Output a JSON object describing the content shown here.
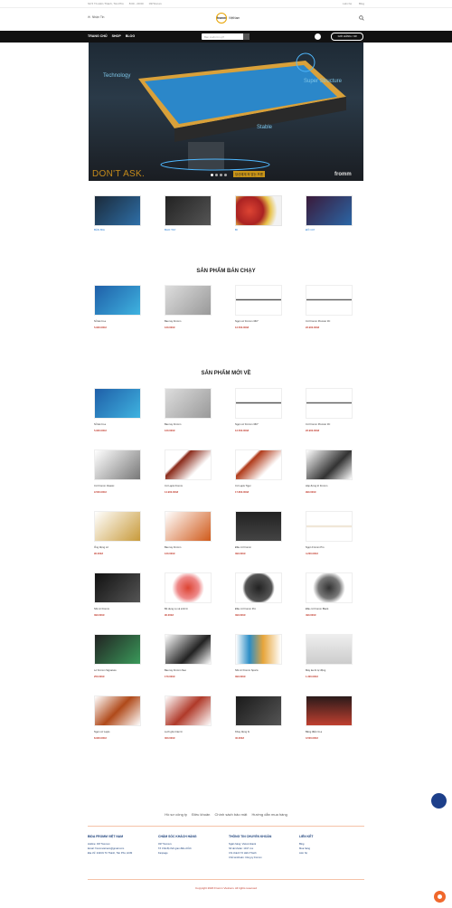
{
  "topbar": {
    "address": "Số 5 Tô Hiến Thành, Tân Phú",
    "hours": "8:00 - 20:00",
    "phone": "0370xxxxx",
    "login": "Liên hệ",
    "blog": "Blog"
  },
  "header": {
    "email_label": "Nhận Tin",
    "logo_text": "fromm",
    "logo_sub": "ViệtNam"
  },
  "nav": {
    "items": [
      "TRANG CHỦ",
      "SHOP",
      "BLOG"
    ],
    "search_placeholder": "Bạn muốn tìm gì?",
    "cart_label": "GIỎ HÀNG / 0đ",
    "cart_count": "0"
  },
  "hero": {
    "tech": "Technology",
    "super": "Super Structure",
    "stable": "Stable",
    "tagline": "DON'T ASK.",
    "brand": "fromm",
    "korean": "당신에게 꼭 맞는 프롬"
  },
  "categories": [
    "BÀN BIA",
    "BAO TAY",
    "BI",
    "ĐỒ CƠ"
  ],
  "best_sellers": {
    "title": "SẢN PHẨM BÁN CHẠY",
    "items": [
      {
        "name": "Nỉ bàn bi-a",
        "price": "5.900.000đ"
      },
      {
        "name": "Bao tay Fromm",
        "price": "120.000đ"
      },
      {
        "name": "Ngọn cơ Fromm 360°",
        "price": "12.500.000đ"
      },
      {
        "name": "Cơ Fromm Premier 3C",
        "price": "22.900.000đ"
      }
    ]
  },
  "new_products": {
    "title": "SẢN PHẨM MỚI VỀ",
    "items": [
      {
        "name": "Nỉ bàn bi-a",
        "price": "5.900.000đ"
      },
      {
        "name": "Bao tay Fromm",
        "price": "120.000đ"
      },
      {
        "name": "Ngọn cơ Fromm 360°",
        "price": "12.500.000đ"
      },
      {
        "name": "Cơ Fromm Premier 3C",
        "price": "22.900.000đ"
      },
      {
        "name": "Cơ Fromm Classic",
        "price": "9.500.000đ"
      },
      {
        "name": "Cơ Lapis Fromm",
        "price": "14.900.000đ"
      },
      {
        "name": "Cơ Lapis Tiger",
        "price": "17.800.000đ"
      },
      {
        "name": "Hộp đựng lơ Fromm",
        "price": "990.000đ"
      },
      {
        "name": "Ống đựng cơ",
        "price": "90.000đ"
      },
      {
        "name": "Bao tay Fromm",
        "price": "120.000đ"
      },
      {
        "name": "Đầu cơ Fromm",
        "price": "390.000đ"
      },
      {
        "name": "Ngọn Fromm Pro",
        "price": "4.200.000đ"
      },
      {
        "name": "Nối cơ Fromm",
        "price": "390.000đ"
      },
      {
        "name": "Bộ dụng cụ vệ sinh bi",
        "price": "90.000đ"
      },
      {
        "name": "Đầu cơ Fromm Pro",
        "price": "390.000đ"
      },
      {
        "name": "Đầu cơ Fromm Black",
        "price": "490.000đ"
      },
      {
        "name": "Lơ Fromm Signature",
        "price": "250.000đ"
      },
      {
        "name": "Bao tay Fromm Neo",
        "price": "170.000đ"
      },
      {
        "name": "Nối cơ Fromm Sports",
        "price": "390.000đ"
      },
      {
        "name": "Máy lau bi tự động",
        "price": "1.300.000đ"
      },
      {
        "name": "Ngọn cơ Lapis",
        "price": "8.900.000đ"
      },
      {
        "name": "Lưới gôm bàn bi",
        "price": "300.000đ"
      },
      {
        "name": "Khay đựng bi",
        "price": "40.000đ"
      },
      {
        "name": "Bảng điểm bi-a",
        "price": "3.500.000đ"
      }
    ]
  },
  "footer": {
    "links": [
      "Hồ sơ công ty",
      "Điều khoản",
      "Chính sách bảo mật",
      "Hướng dẫn mua hàng"
    ],
    "col1": {
      "title": "BIDA FROMM VIỆT NAM",
      "lines": [
        "Hotline: 037 5xxxxxx",
        "Email: frommvietnam@gmail.com",
        "Địa chỉ: 242/31 Tô Thành, Tân Phú, HCM"
      ]
    },
    "col2": {
      "title": "CHĂM SÓC KHÁCH HÀNG",
      "lines": [
        "037 5xxxxxx",
        "Tổ Chế độ thời gian điều chỉnh",
        "Fanpage"
      ]
    },
    "col3": {
      "title": "THÔNG TIN CHUYỂN KHOẢN",
      "lines": [
        "Ngân hàng: Vietcombank",
        "Số tài khoản: 1017 xxx",
        "Chi nhánh Tô Hiến Thành",
        "Chủ tài khoản: Công ty Fromm"
      ]
    },
    "col4": {
      "title": "LIÊN KẾT",
      "lines": [
        "Blog",
        "Mua hàng",
        "Liên hệ"
      ]
    },
    "copyright": "Copyright 2020 Fromm Vietnam. All rights reserved"
  }
}
